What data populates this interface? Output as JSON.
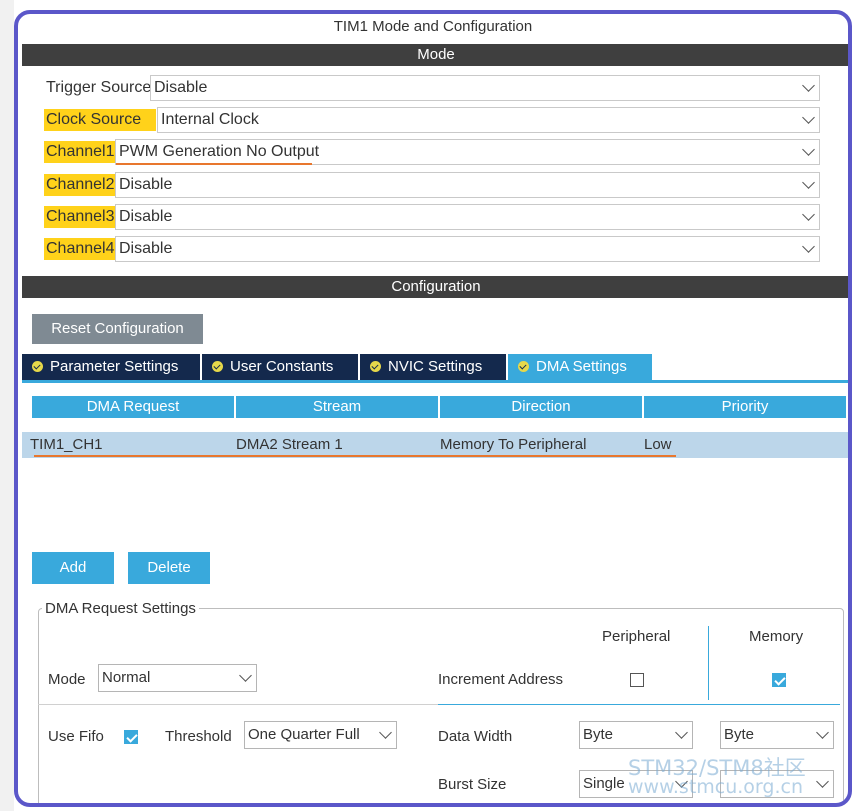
{
  "window_title": "TIM1 Mode and Configuration",
  "mode_section": {
    "title": "Mode",
    "rows": [
      {
        "label": "Trigger Source",
        "value": "Disable",
        "highlighted": false
      },
      {
        "label": "Clock Source",
        "value": "Internal Clock",
        "highlighted": true
      },
      {
        "label": "Channel1",
        "value": "PWM Generation No Output",
        "highlighted": true
      },
      {
        "label": "Channel2",
        "value": "Disable",
        "highlighted": true
      },
      {
        "label": "Channel3",
        "value": "Disable",
        "highlighted": true
      },
      {
        "label": "Channel4",
        "value": "Disable",
        "highlighted": true
      }
    ]
  },
  "config_section": {
    "title": "Configuration",
    "reset_button": "Reset Configuration",
    "tabs": [
      {
        "label": "Parameter Settings",
        "active": false
      },
      {
        "label": "User Constants",
        "active": false
      },
      {
        "label": "NVIC Settings",
        "active": false
      },
      {
        "label": "DMA Settings",
        "active": true
      }
    ]
  },
  "dma_table": {
    "headers": [
      "DMA Request",
      "Stream",
      "Direction",
      "Priority"
    ],
    "rows": [
      [
        "TIM1_CH1",
        "DMA2 Stream 1",
        "Memory To Peripheral",
        "Low"
      ]
    ]
  },
  "buttons": {
    "add": "Add",
    "delete": "Delete"
  },
  "dma_request_settings": {
    "title": "DMA Request Settings",
    "peripheral_header": "Peripheral",
    "memory_header": "Memory",
    "mode_label": "Mode",
    "mode_value": "Normal",
    "increment_address_label": "Increment Address",
    "increment_peripheral_checked": false,
    "increment_memory_checked": true,
    "use_fifo_label": "Use Fifo",
    "use_fifo_checked": true,
    "threshold_label": "Threshold",
    "threshold_value": "One Quarter Full",
    "data_width_label": "Data Width",
    "data_width_peripheral": "Byte",
    "data_width_memory": "Byte",
    "burst_size_label": "Burst Size",
    "burst_size_peripheral": "Single"
  },
  "watermark": {
    "line1": "STM32/STM8社区",
    "line2": "www.stmcu.org.cn"
  },
  "colors": {
    "accent": "#39a9dc",
    "highlight": "#ffd21a",
    "frame": "#5b57c9",
    "tab_dark": "#14294d",
    "underline": "#e8772e"
  }
}
